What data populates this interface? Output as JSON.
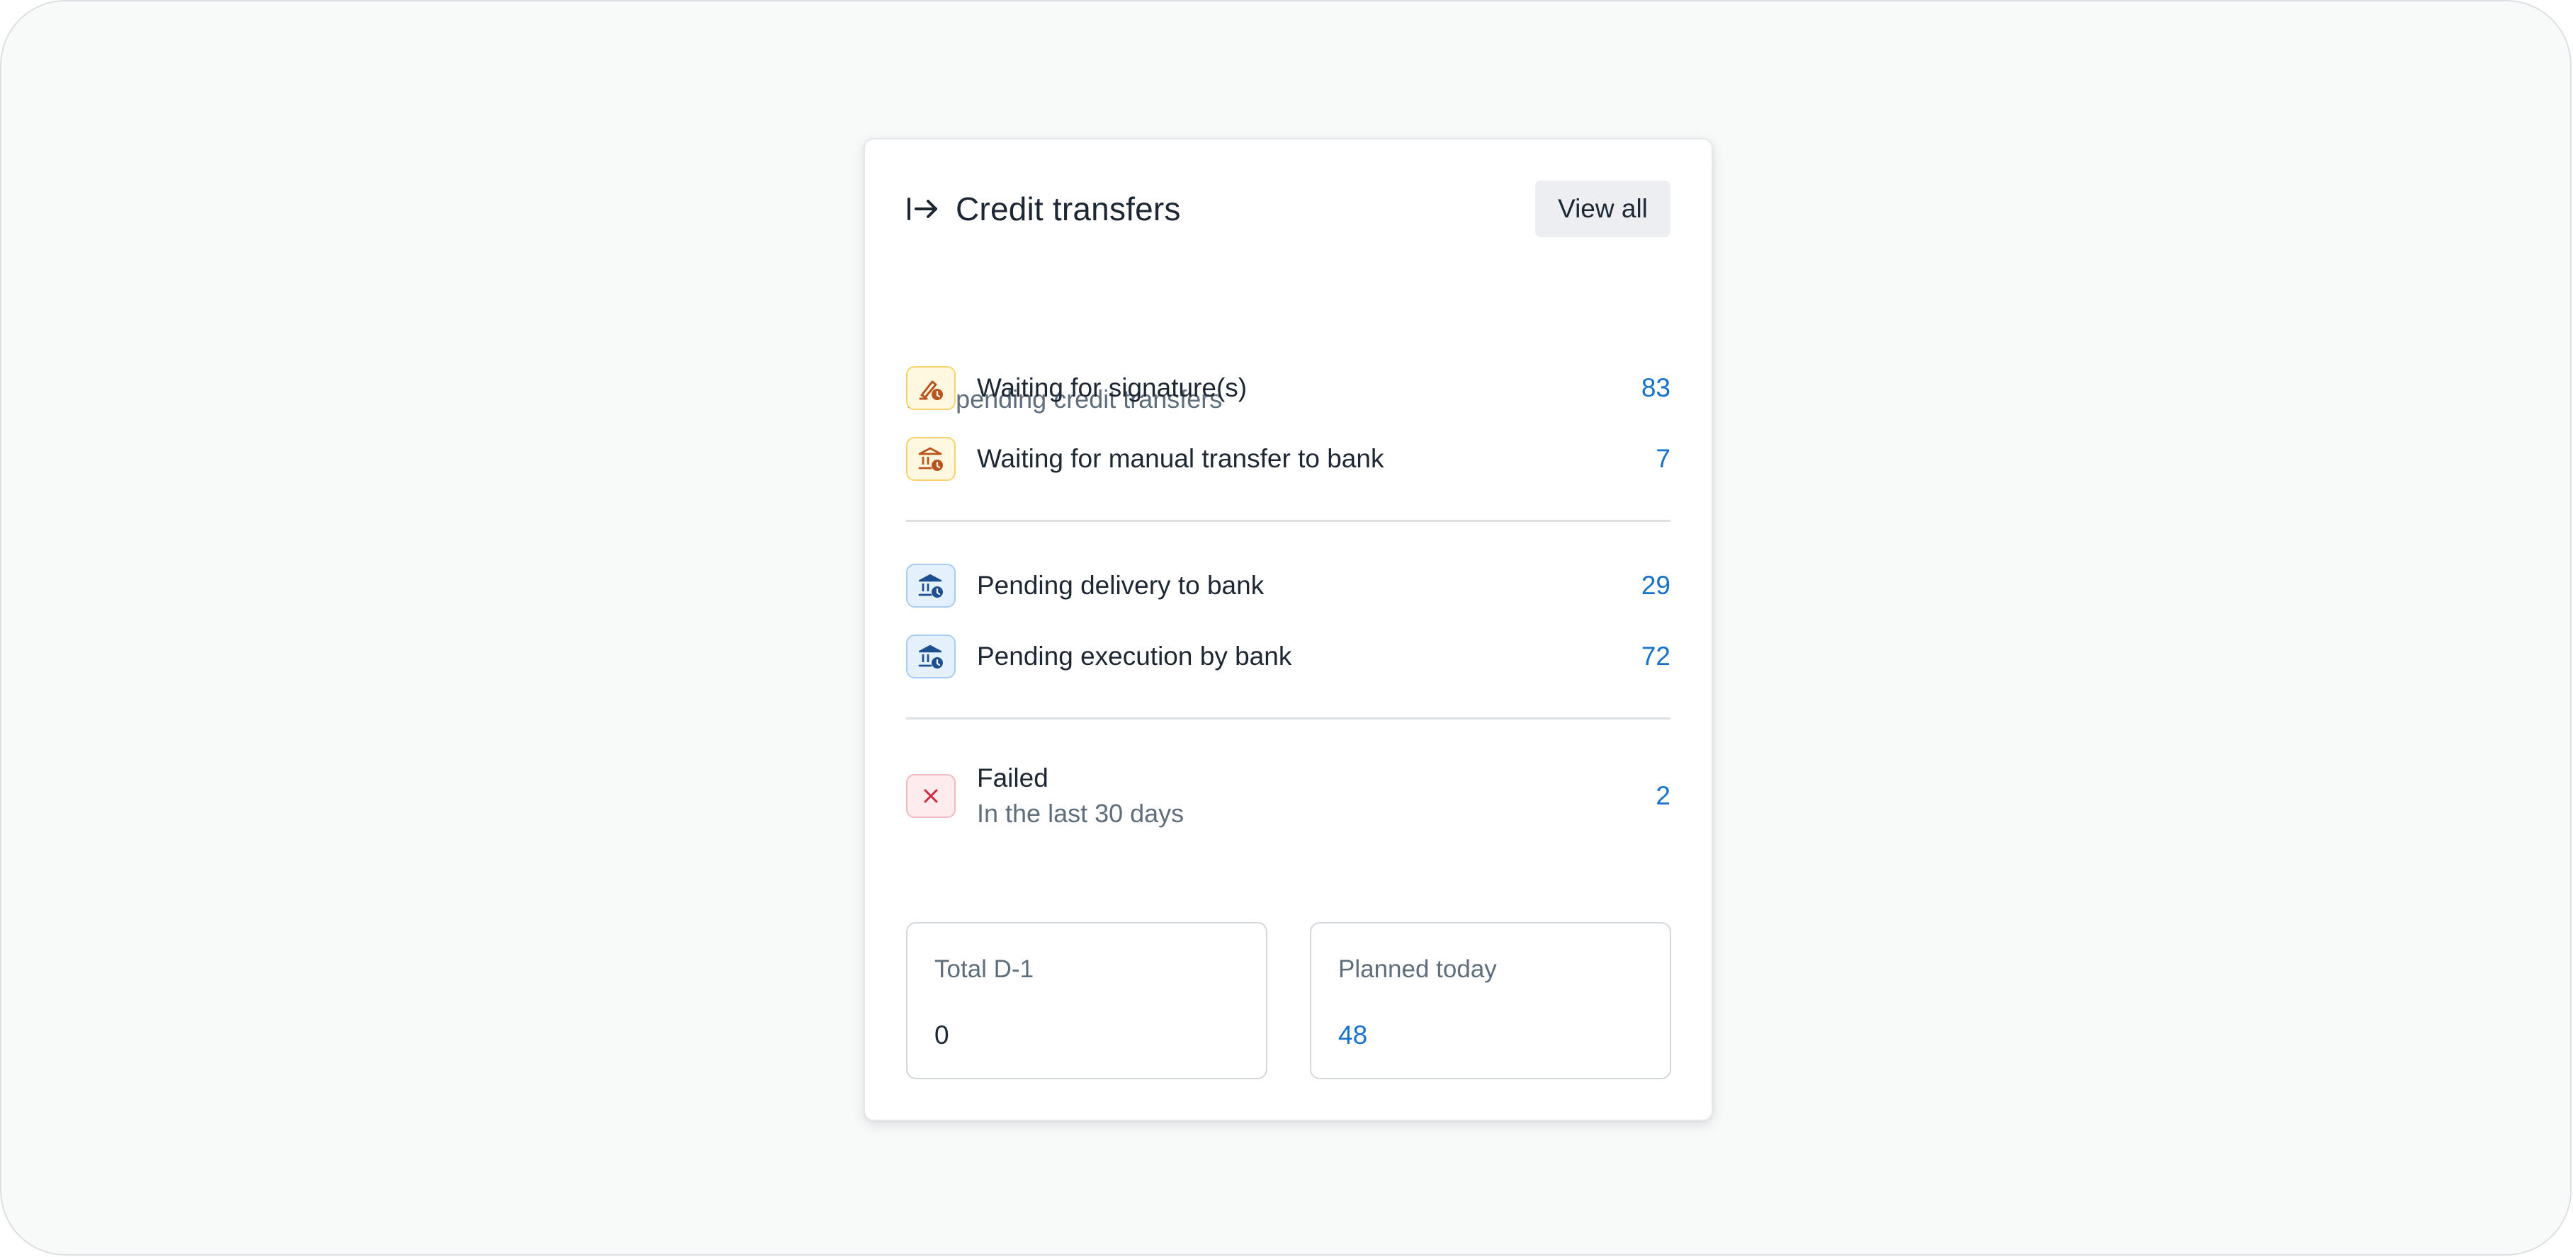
{
  "card": {
    "title": "Credit transfers",
    "subtitle": "173 pending credit transfers",
    "view_all_label": "View all",
    "title_icon": "arrow-right-from-bar-icon"
  },
  "rows": [
    {
      "label": "Waiting for signature(s)",
      "count": "83",
      "icon": "signature-pending-icon",
      "tone": "orange"
    },
    {
      "label": "Waiting for manual transfer to bank",
      "count": "7",
      "icon": "bank-pending-icon",
      "tone": "orange"
    },
    {
      "label": "Pending delivery to bank",
      "count": "29",
      "icon": "bank-clock-icon",
      "tone": "blue"
    },
    {
      "label": "Pending execution by bank",
      "count": "72",
      "icon": "bank-clock-icon",
      "tone": "blue"
    }
  ],
  "failed": {
    "label": "Failed",
    "sublabel": "In the last 30 days",
    "count": "2",
    "icon": "close-x-icon",
    "tone": "red"
  },
  "stats": {
    "total_d1": {
      "label": "Total D-1",
      "value": "0"
    },
    "planned_today": {
      "label": "Planned today",
      "value": "48"
    }
  },
  "colors": {
    "accent": "#1672cc",
    "text": "#1c2733",
    "muted": "#5f6e7d",
    "orange_icon": "#b8541c",
    "blue_icon": "#1e4f91",
    "red_icon": "#d0283e"
  }
}
